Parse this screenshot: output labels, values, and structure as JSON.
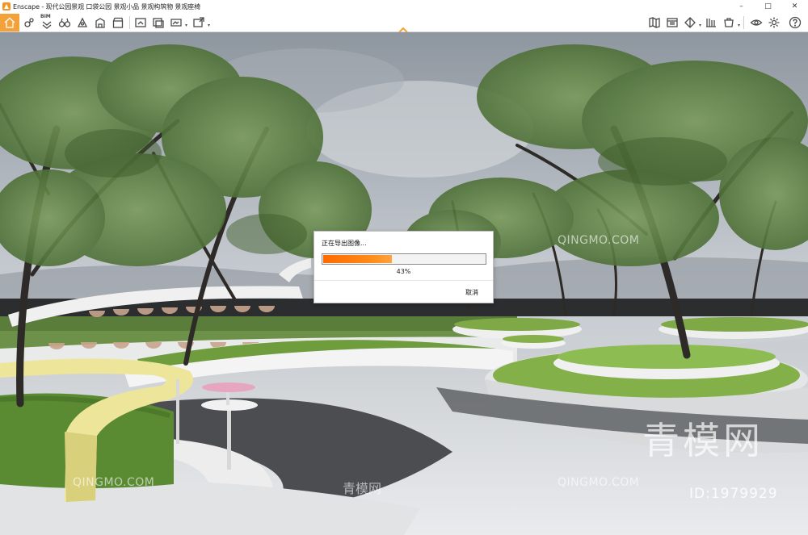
{
  "window": {
    "title": "Enscape - 现代公园景观 口袋公园 景观小品 景观构筑物 景观座椅",
    "controls": {
      "minimize": "–",
      "maximize": "□",
      "close": "✕"
    }
  },
  "toolbar": {
    "bim_label": "BIM",
    "left_icons": [
      "home-icon",
      "views-icon",
      "bim-icon",
      "binoculars-icon",
      "sun-icon",
      "building-icon",
      "capture-icon",
      "screenshot-icon",
      "panorama-icon",
      "video-icon",
      "export-icon"
    ],
    "right_icons": [
      "map-icon",
      "window-icon",
      "asset-icon",
      "vr-icon",
      "material-icon",
      "eye-icon",
      "settings-icon",
      "help-icon"
    ]
  },
  "dialog": {
    "title": "正在导出图像...",
    "progress_percent": 43,
    "progress_text": "43%",
    "cancel_label": "取消",
    "accent_color": "#ff7b00"
  },
  "watermarks": {
    "brand_cn": "青模网",
    "brand_en": "QINGMO.COM",
    "id_text": "ID:1979929"
  },
  "colors": {
    "home_accent": "#f5a139"
  }
}
